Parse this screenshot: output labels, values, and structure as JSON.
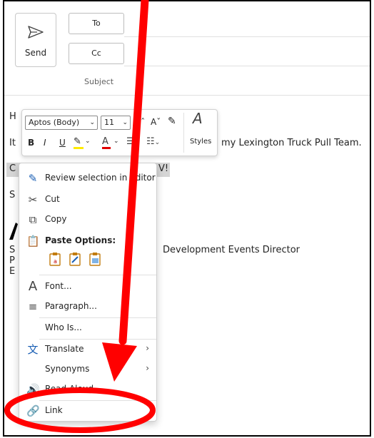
{
  "compose": {
    "send_label": "Send",
    "to_label": "To",
    "cc_label": "Cc",
    "subject_placeholder": "Subject"
  },
  "body": {
    "line_h": "H",
    "line_it_start": "It",
    "line_it_end": "my Lexington Truck Pull Team.",
    "selection_start": "C",
    "selection_end": "V!",
    "line_s": "S",
    "signature_partial": "Development Events Director",
    "line_s2": "S",
    "line_p": "P",
    "line_e": "E"
  },
  "mini_toolbar": {
    "font_name": "Aptos (Body)",
    "font_size": "11",
    "grow_font": "Aˆ",
    "shrink_font": "Aˇ",
    "bold": "B",
    "italic": "I",
    "underline": "U",
    "styles_label": "Styles"
  },
  "context_menu": {
    "review_editor": "Review selection in Editor",
    "cut": "Cut",
    "copy": "Copy",
    "paste_options": "Paste Options:",
    "font": "Font...",
    "paragraph": "Paragraph...",
    "who_is": "Who Is...",
    "translate": "Translate",
    "synonyms": "Synonyms",
    "read_aloud": "Read Aloud",
    "link": "Link"
  },
  "annotation": {
    "arrow_color": "#ff0000",
    "circle_color": "#ff0000"
  }
}
